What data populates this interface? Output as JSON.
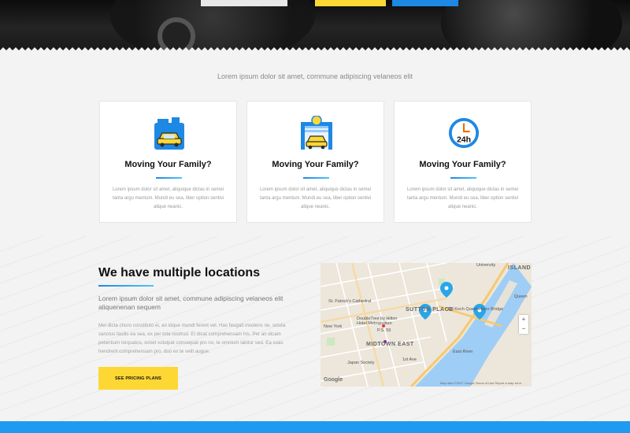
{
  "hero": {
    "accent_yellow": "#fdd835",
    "accent_blue": "#1e88e5"
  },
  "intro": {
    "text": "Lorem ipsum dolor sit amet, commune adipiscing velaneos elit"
  },
  "features": [
    {
      "icon": "fuel-can-car-icon",
      "title": "Moving Your Family?",
      "body": "Lorem ipsum dolor sit amet, aliquique dictas in semei tanta argu mentum. Mundi eu sea, liber option sentivi alique neanic."
    },
    {
      "icon": "car-wash-garage-icon",
      "title": "Moving Your Family?",
      "body": "Lorem ipsum dolor sit amet, aliquique dictas in semei tanta argu mentum. Mundi eu sea, liber option sentivi alique neanic."
    },
    {
      "icon": "24h-clock-icon",
      "title": "Moving Your Family?",
      "body": "Lorem ipsum dolor sit amet, aliquique dictas in semei tanta argu mentum. Mundi eu sea, liber option sentivi alique neanic."
    }
  ],
  "locations": {
    "title": "We have multiple locations",
    "lead": "Lorem ipsum dolor sit amet, commune adipiscing velaneos elit aliquenenan sequem",
    "body": "Mei dicta choro constituto ei, an idque mundi ferent vel. Has feugait insolens ne, soluta sanctus facilis ea sea, ex per tota nostrud. Et dicat comprehensam his. Per an dicam petentium torquatos, sonet volutpat consequat pro no, te omnium labitur sed. Ea suas hendrerit comprehensam pro, duo ex te velit augue.",
    "button_label": "SEE PRICING PLANS"
  },
  "map": {
    "labels": {
      "sutton_place": "SUTTON PLACE",
      "midtown_east": "MIDTOWN EAST",
      "island": "ISLAND",
      "university": "University",
      "st_patricks": "St. Patrick's Cathedral",
      "doubletree": "DoubleTree by Hilton Hotel Metropolitan",
      "new_york": "New York",
      "p50": "P.S. 59",
      "japan_society": "Japan Society",
      "ed_koch": "Ed Koch Queensboro Bridge",
      "queens": "Queen",
      "east_river": "East River",
      "first_ave": "1st Ave"
    },
    "zoom_in": "+",
    "zoom_out": "−",
    "google": "Google",
    "attribution": "Map data ©2017 Google   Terms of Use   Report a map error"
  }
}
